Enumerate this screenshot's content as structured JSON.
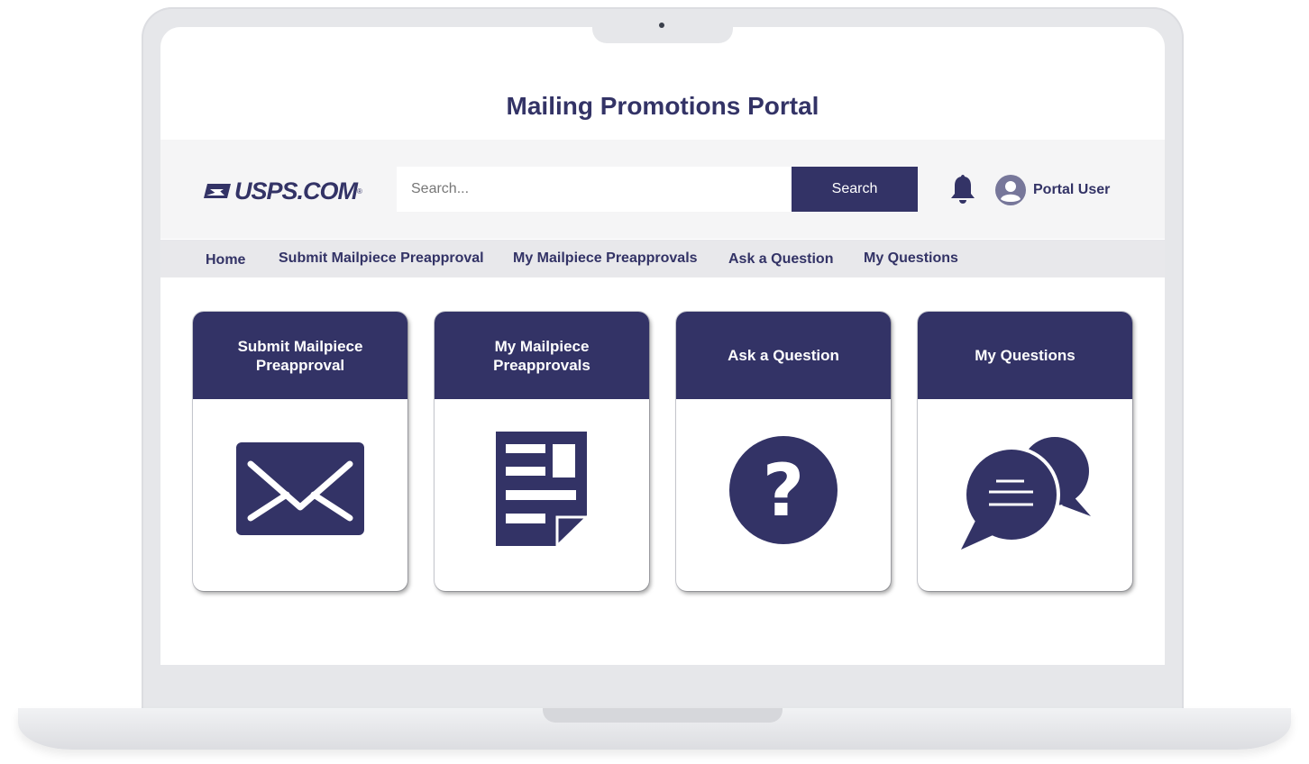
{
  "portal": {
    "title": "Mailing Promotions Portal"
  },
  "header": {
    "logo_text": "USPS.COM",
    "logo_mark": "®",
    "search_placeholder": "Search...",
    "search_button": "Search",
    "bell_icon": "bell-icon",
    "avatar_icon": "user-avatar-icon",
    "user_name": "Portal User"
  },
  "nav": {
    "items": [
      {
        "label": "Home"
      },
      {
        "label": "Submit Mailpiece Preapproval"
      },
      {
        "label": "My Mailpiece Preapprovals"
      },
      {
        "label": "Ask a Question"
      },
      {
        "label": "My Questions"
      }
    ]
  },
  "cards": [
    {
      "label": "Submit Mailpiece Preapproval",
      "icon": "envelope-icon"
    },
    {
      "label": "My Mailpiece Preapprovals",
      "icon": "document-icon"
    },
    {
      "label": "Ask a Question",
      "icon": "question-icon"
    },
    {
      "label": "My Questions",
      "icon": "chat-bubbles-icon"
    }
  ],
  "colors": {
    "brand": "#333366",
    "header_band": "#f5f5f6",
    "nav_band": "#e8e8eb"
  }
}
